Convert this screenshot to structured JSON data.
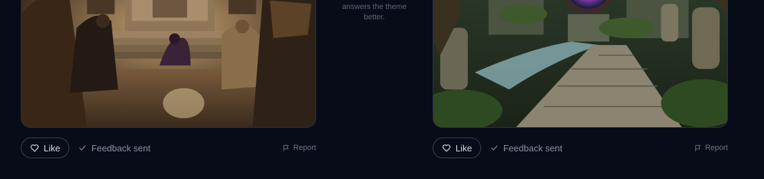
{
  "center_note": {
    "line1": "answers the theme",
    "line2": "better."
  },
  "cards": [
    {
      "image_alt": "Hooded figures kneeling before a marble throne",
      "like_label": "Like",
      "like_icon": "heart-icon",
      "feedback_label": "Feedback sent",
      "feedback_icon": "check-icon",
      "report_label": "Report",
      "report_icon": "flag-icon"
    },
    {
      "image_alt": "Overgrown jungle temple path with a glowing portal",
      "like_label": "Like",
      "like_icon": "heart-icon",
      "feedback_label": "Feedback sent",
      "feedback_icon": "check-icon",
      "report_label": "Report",
      "report_icon": "flag-icon"
    }
  ],
  "colors": {
    "background": "#080c18",
    "border": "#2a3142",
    "muted_text": "#8a92a4"
  }
}
